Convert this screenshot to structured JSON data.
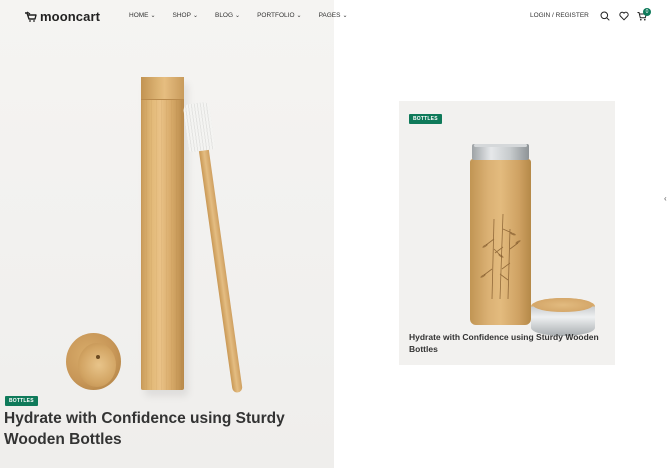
{
  "header": {
    "logo_text": "mooncart",
    "nav": [
      {
        "label": "HOME"
      },
      {
        "label": "SHOP"
      },
      {
        "label": "BLOG"
      },
      {
        "label": "PORTFOLIO"
      },
      {
        "label": "PAGES"
      }
    ],
    "login_label": "LOGIN / REGISTER",
    "cart_count": "0",
    "icons": [
      "search-icon",
      "heart-icon",
      "cart-icon"
    ]
  },
  "hero": {
    "tag": "BOTTLES",
    "title": "Hydrate with Confidence using Sturdy Wooden Bottles"
  },
  "card": {
    "tag": "BOTTLES",
    "title": "Hydrate with Confidence using Sturdy Wooden Bottles"
  },
  "colors": {
    "accent": "#0f7a5a",
    "hero_bg": "#f3f2f0",
    "card_bg": "#f2f1ef"
  }
}
